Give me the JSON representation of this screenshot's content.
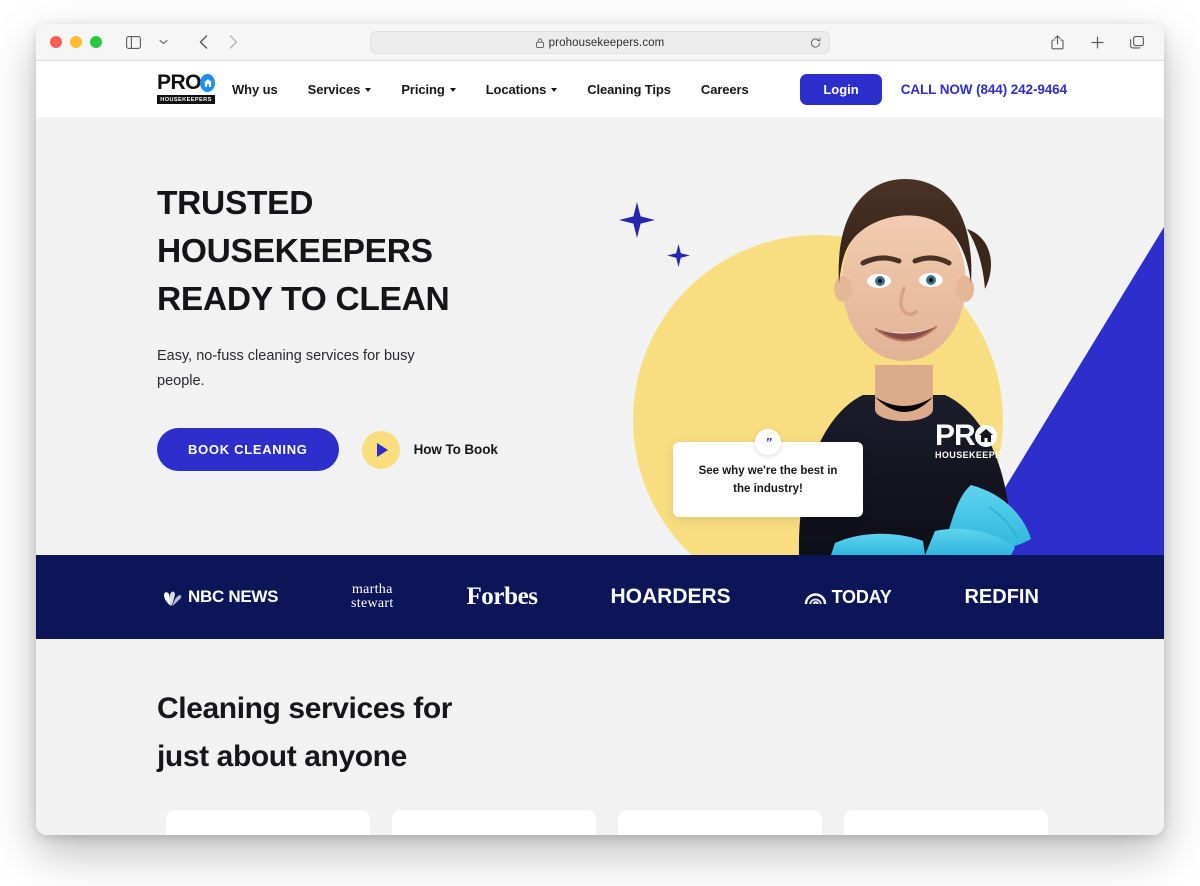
{
  "browser": {
    "url": "prohousekeepers.com",
    "lock_icon": "lock-icon",
    "reload_icon": "reload-icon",
    "sidebar_icon": "sidebar-icon",
    "chevron_down_icon": "chevron-down-icon",
    "back_icon": "back-arrow-icon",
    "forward_icon": "forward-arrow-icon",
    "share_icon": "share-icon",
    "new_tab_icon": "plus-icon",
    "tabs_icon": "tabs-overview-icon"
  },
  "site": {
    "logo": {
      "primary": "PRO",
      "sub": "HOUSEKEEPERS"
    },
    "nav": [
      {
        "label": "Why us",
        "has_caret": false
      },
      {
        "label": "Services",
        "has_caret": true
      },
      {
        "label": "Pricing",
        "has_caret": true
      },
      {
        "label": "Locations",
        "has_caret": true
      },
      {
        "label": "Cleaning Tips",
        "has_caret": false
      },
      {
        "label": "Careers",
        "has_caret": false
      }
    ],
    "login_label": "Login",
    "call_now": "CALL NOW (844) 242-9464",
    "accent_blue": "#2e2ecc",
    "navy": "#0d1559",
    "yellow": "#f8de81"
  },
  "hero": {
    "title_line1": "TRUSTED HOUSEKEEPERS",
    "title_line2": "READY TO CLEAN",
    "subtitle": "Easy, no-fuss cleaning services for busy people.",
    "primary_cta": "BOOK CLEANING",
    "secondary_cta": "How To Book",
    "testimonial": "See why we're the best in the industry!",
    "quote_mark": "”"
  },
  "press": {
    "logos": [
      {
        "id": "nbc-news",
        "label": "NBC NEWS"
      },
      {
        "id": "martha-stewart",
        "label_line1": "martha",
        "label_line2": "stewart"
      },
      {
        "id": "forbes",
        "label": "Forbes"
      },
      {
        "id": "hoarders",
        "label": "HOARDERS"
      },
      {
        "id": "today",
        "label": "TODAY"
      },
      {
        "id": "redfin",
        "label": "REDFIN"
      }
    ]
  },
  "services": {
    "title_line1": "Cleaning services for",
    "title_line2": "just about anyone",
    "cards": [
      "",
      "",
      "",
      ""
    ]
  }
}
